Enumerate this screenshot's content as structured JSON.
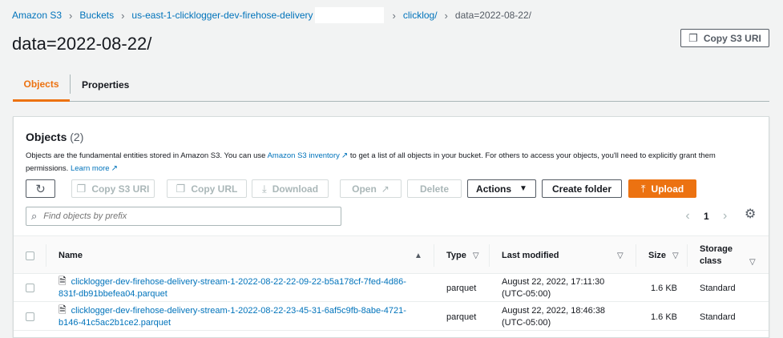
{
  "breadcrumb": {
    "items": [
      "Amazon S3",
      "Buckets",
      "us-east-1-clicklogger-dev-firehose-delivery",
      "clicklog/"
    ],
    "current": "data=2022-08-22/"
  },
  "page": {
    "title": "data=2022-08-22/",
    "copy_uri_label": "Copy S3 URI"
  },
  "tabs": [
    {
      "label": "Objects",
      "active": true
    },
    {
      "label": "Properties",
      "active": false
    }
  ],
  "panel": {
    "title": "Objects",
    "count": "(2)",
    "desc_part1": "Objects are the fundamental entities stored in Amazon S3. You can use",
    "desc_link1": "Amazon S3 inventory",
    "desc_part2": "to get a list of all objects in your bucket. For others to access your objects, you'll need to explicitly grant them permissions.",
    "desc_link2": "Learn more"
  },
  "toolbar": {
    "refresh_label": "",
    "copy_s3_uri": "Copy S3 URI",
    "copy_url": "Copy URL",
    "download": "Download",
    "open": "Open",
    "delete": "Delete",
    "actions": "Actions",
    "create_folder": "Create folder",
    "upload": "Upload"
  },
  "search": {
    "placeholder": "Find objects by prefix"
  },
  "pager": {
    "page": "1"
  },
  "table": {
    "columns": {
      "name": "Name",
      "type": "Type",
      "last_modified": "Last modified",
      "size": "Size",
      "storage_class_1": "Storage",
      "storage_class_2": "class"
    },
    "rows": [
      {
        "name_line1": "clicklogger-dev-firehose-delivery-stream-1-2022-08-22-22-09-22-b5a178cf-7fed-4d86-",
        "name_line2": "831f-db91bbefea04.parquet",
        "type": "parquet",
        "modified_line1": "August 22, 2022, 17:11:30",
        "modified_line2": "(UTC-05:00)",
        "size": "1.6 KB",
        "storage_class": "Standard"
      },
      {
        "name_line1": "clicklogger-dev-firehose-delivery-stream-1-2022-08-22-23-45-31-6af5c9fb-8abe-4721-",
        "name_line2": "b146-41c5ac2b1ce2.parquet",
        "type": "parquet",
        "modified_line1": "August 22, 2022, 18:46:38",
        "modified_line2": "(UTC-05:00)",
        "size": "1.6 KB",
        "storage_class": "Standard"
      }
    ]
  },
  "colors": {
    "link": "#0073bb",
    "accent": "#ec7211",
    "text": "#16191f",
    "muted": "#545b64"
  }
}
